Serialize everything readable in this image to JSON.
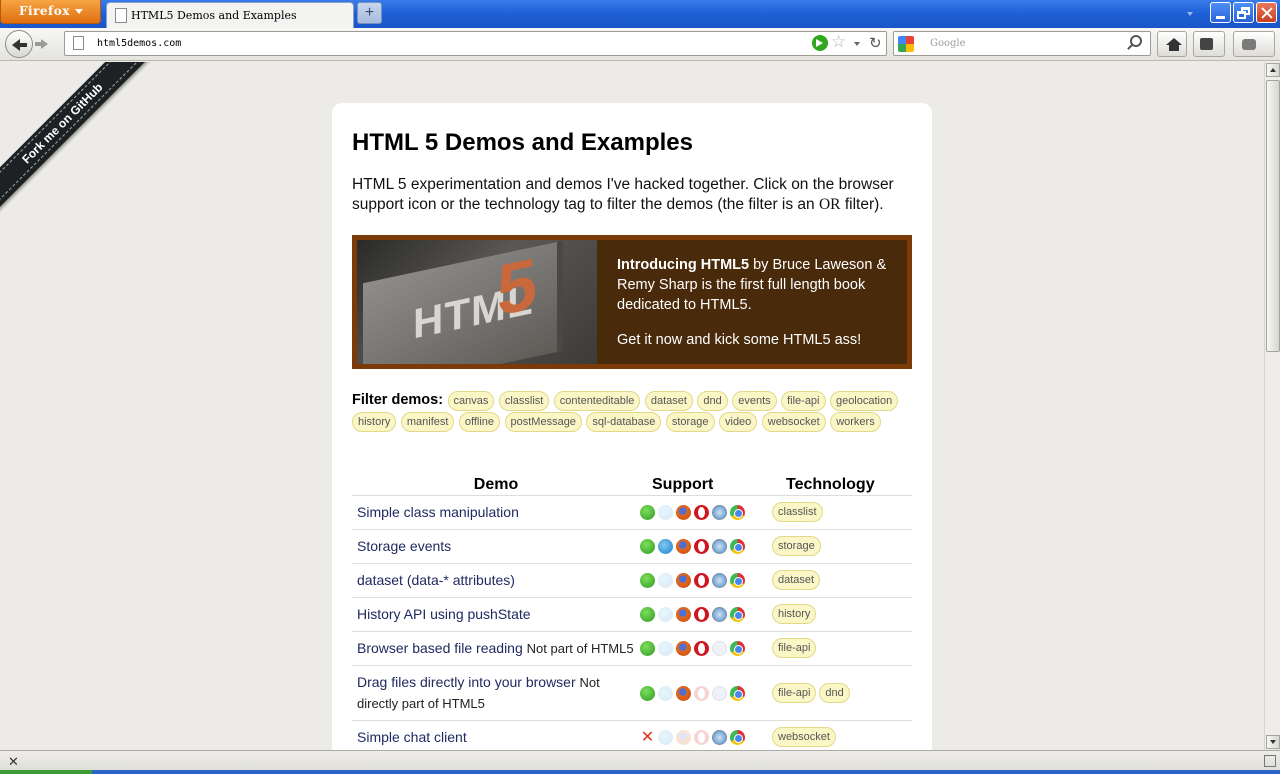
{
  "browser": {
    "menu_label": "Firefox",
    "tab_title": "HTML5 Demos and Examples",
    "new_tab_label": "+",
    "url": "html5demos.com",
    "search_placeholder": "Google"
  },
  "ribbon": {
    "label": "Fork me on GitHub"
  },
  "page": {
    "title": "HTML 5 Demos and Examples",
    "intro_before": "HTML 5 experimentation and demos I've hacked together. Click on the browser support icon or the technology tag to filter the demos (the filter is an ",
    "intro_or": "OR",
    "intro_after": " filter).",
    "book_strong": "Introducing HTML5",
    "book_rest": " by Bruce Laweson & Remy Sharp is the first full length book dedicated to HTML5.",
    "book_cta": "Get it now and kick some HTML5 ass!",
    "book_cover_text": "HTML",
    "book_cover_num": "5",
    "filter_label": "Filter demos:",
    "filter_tags_row1": [
      "canvas",
      "classlist",
      "contenteditable",
      "dataset",
      "dnd",
      "events",
      "file-api",
      "geolocation"
    ],
    "filter_tags_row2": [
      "history",
      "manifest",
      "offline",
      "postMessage",
      "sql-database",
      "storage",
      "video",
      "websocket",
      "workers"
    ]
  },
  "table": {
    "headers": [
      "Demo",
      "Support",
      "Technology"
    ],
    "rows": [
      {
        "title": "Simple class manipulation",
        "note": "",
        "status": "yes",
        "ie": false,
        "ff": true,
        "op": true,
        "sf": true,
        "ch": true,
        "tags": [
          "classlist"
        ]
      },
      {
        "title": "Storage events",
        "note": "",
        "status": "yes",
        "ie": true,
        "ff": true,
        "op": true,
        "sf": true,
        "ch": true,
        "tags": [
          "storage"
        ]
      },
      {
        "title": "dataset (data-* attributes)",
        "note": "",
        "status": "yes",
        "ie": false,
        "ff": true,
        "op": true,
        "sf": true,
        "ch": true,
        "tags": [
          "dataset"
        ]
      },
      {
        "title": "History API using pushState",
        "note": "",
        "status": "yes",
        "ie": false,
        "ff": true,
        "op": true,
        "sf": true,
        "ch": true,
        "tags": [
          "history"
        ]
      },
      {
        "title": "Browser based file reading",
        "note": "Not part of HTML5",
        "status": "yes",
        "ie": false,
        "ff": true,
        "op": true,
        "sf": false,
        "ch": true,
        "tags": [
          "file-api"
        ]
      },
      {
        "title": "Drag files directly into your browser",
        "note": "Not directly part of HTML5",
        "status": "yes",
        "ie": false,
        "ff": true,
        "op": false,
        "sf": false,
        "ch": true,
        "tags": [
          "file-api",
          "dnd"
        ]
      },
      {
        "title": "Simple chat client",
        "note": "",
        "status": "no",
        "ie": false,
        "ff": false,
        "op": false,
        "sf": true,
        "ch": true,
        "tags": [
          "websocket"
        ]
      }
    ]
  }
}
